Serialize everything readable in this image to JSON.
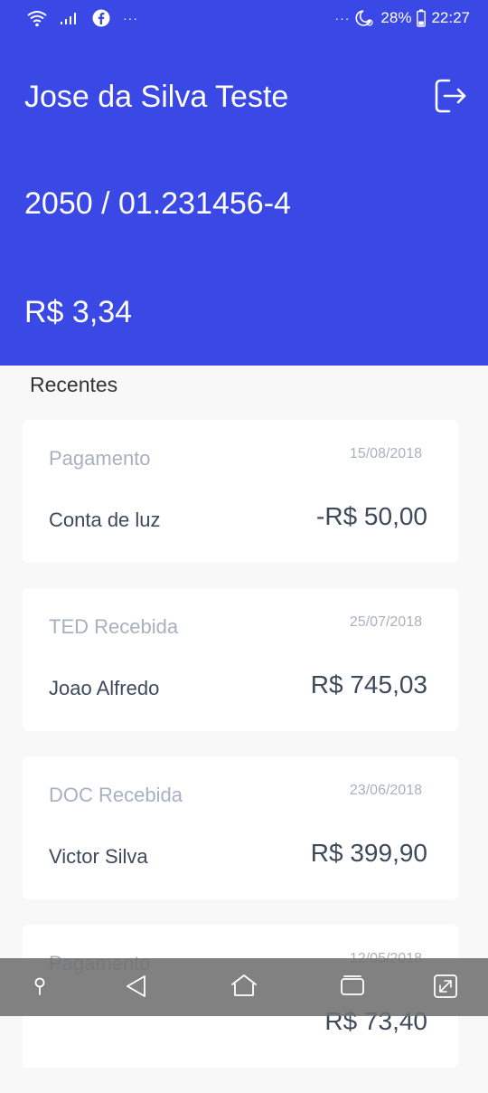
{
  "status_bar": {
    "left_more": "···",
    "right_more": "···",
    "battery_percent": "28%",
    "time": "22:27"
  },
  "header": {
    "user_name": "Jose da Silva Teste",
    "account": "2050 / 01.231456-4",
    "balance": "R$ 3,34",
    "background_color": "#3a48e6"
  },
  "recent": {
    "title": "Recentes",
    "transactions": [
      {
        "type": "Pagamento",
        "date": "15/08/2018",
        "description": "Conta de luz",
        "amount": "-R$ 50,00"
      },
      {
        "type": "TED Recebida",
        "date": "25/07/2018",
        "description": "Joao Alfredo",
        "amount": "R$ 745,03"
      },
      {
        "type": "DOC Recebida",
        "date": "23/06/2018",
        "description": "Victor Silva",
        "amount": "R$ 399,90"
      },
      {
        "type": "Pagamento",
        "date": "12/05/2018",
        "description": "",
        "amount": "R$ 73,40"
      }
    ]
  },
  "icons": {
    "logout": "logout-icon",
    "nav": [
      "pin-icon",
      "back-icon",
      "home-icon",
      "recents-icon",
      "expand-icon"
    ]
  }
}
